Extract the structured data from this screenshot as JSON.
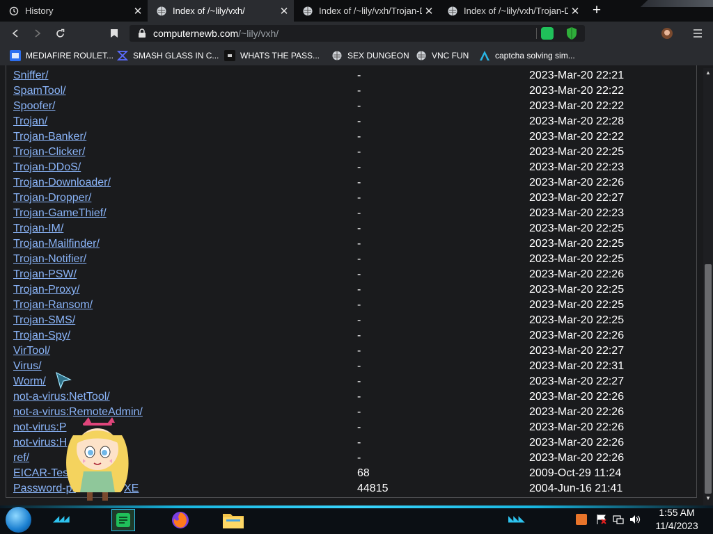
{
  "browser": {
    "tabs": [
      {
        "title": "History",
        "icon": "clock-icon"
      },
      {
        "title": "Index of /~lily/vxh/",
        "icon": "globe-icon"
      },
      {
        "title": "Index of /~lily/vxh/Trojan-Do",
        "icon": "globe-icon"
      },
      {
        "title": "Index of /~lily/vxh/Trojan-Do",
        "icon": "globe-icon"
      }
    ],
    "url_host": "computernewb.com",
    "url_path": "/~lily/vxh/",
    "bookmarks": [
      {
        "label": "MEDIAFIRE ROULET..."
      },
      {
        "label": "SMASH GLASS IN C..."
      },
      {
        "label": "WHATS THE PASS..."
      },
      {
        "label": "SEX DUNGEON"
      },
      {
        "label": "VNC FUN"
      },
      {
        "label": "captcha solving sim..."
      }
    ]
  },
  "listing": [
    {
      "name": "Sniffer/",
      "size": "-",
      "date": "2023-Mar-20 22:21"
    },
    {
      "name": "SpamTool/",
      "size": "-",
      "date": "2023-Mar-20 22:22"
    },
    {
      "name": "Spoofer/",
      "size": "-",
      "date": "2023-Mar-20 22:22"
    },
    {
      "name": "Trojan/",
      "size": "-",
      "date": "2023-Mar-20 22:28"
    },
    {
      "name": "Trojan-Banker/",
      "size": "-",
      "date": "2023-Mar-20 22:22"
    },
    {
      "name": "Trojan-Clicker/",
      "size": "-",
      "date": "2023-Mar-20 22:25"
    },
    {
      "name": "Trojan-DDoS/",
      "size": "-",
      "date": "2023-Mar-20 22:23"
    },
    {
      "name": "Trojan-Downloader/",
      "size": "-",
      "date": "2023-Mar-20 22:26"
    },
    {
      "name": "Trojan-Dropper/",
      "size": "-",
      "date": "2023-Mar-20 22:27"
    },
    {
      "name": "Trojan-GameThief/",
      "size": "-",
      "date": "2023-Mar-20 22:23"
    },
    {
      "name": "Trojan-IM/",
      "size": "-",
      "date": "2023-Mar-20 22:25"
    },
    {
      "name": "Trojan-Mailfinder/",
      "size": "-",
      "date": "2023-Mar-20 22:25"
    },
    {
      "name": "Trojan-Notifier/",
      "size": "-",
      "date": "2023-Mar-20 22:25"
    },
    {
      "name": "Trojan-PSW/",
      "size": "-",
      "date": "2023-Mar-20 22:26"
    },
    {
      "name": "Trojan-Proxy/",
      "size": "-",
      "date": "2023-Mar-20 22:25"
    },
    {
      "name": "Trojan-Ransom/",
      "size": "-",
      "date": "2023-Mar-20 22:25"
    },
    {
      "name": "Trojan-SMS/",
      "size": "-",
      "date": "2023-Mar-20 22:25"
    },
    {
      "name": "Trojan-Spy/",
      "size": "-",
      "date": "2023-Mar-20 22:26"
    },
    {
      "name": "VirTool/",
      "size": "-",
      "date": "2023-Mar-20 22:27"
    },
    {
      "name": "Virus/",
      "size": "-",
      "date": "2023-Mar-20 22:31"
    },
    {
      "name": "Worm/",
      "size": "-",
      "date": "2023-Mar-20 22:27"
    },
    {
      "name": "not-a-virus:NetTool/",
      "size": "-",
      "date": "2023-Mar-20 22:26"
    },
    {
      "name": "not-a-virus:RemoteAdmin/",
      "size": "-",
      "date": "2023-Mar-20 22:26"
    },
    {
      "name": "not-virus:P",
      "size": "-",
      "date": "2023-Mar-20 22:26"
    },
    {
      "name": "not-virus:H",
      "size": "-",
      "date": "2023-Mar-20 22:26"
    },
    {
      "name": "ref/",
      "size": "-",
      "date": "2023-Mar-20 22:26"
    },
    {
      "name": "EICAR-Test",
      "size": "68",
      "date": "2009-Oct-29 11:24"
    },
    {
      "name": "Password-pr",
      "size": "44815",
      "date": "2004-Jun-16 21:41"
    }
  ],
  "listing_tail": "XE",
  "taskbar": {
    "time": "1:55 AM",
    "date": "11/4/2023",
    "accent": "#18b6e0"
  },
  "colors": {
    "link": "#8ab4f8",
    "page_bg": "#1a1b1d",
    "tab_active": "#2a2c30"
  }
}
